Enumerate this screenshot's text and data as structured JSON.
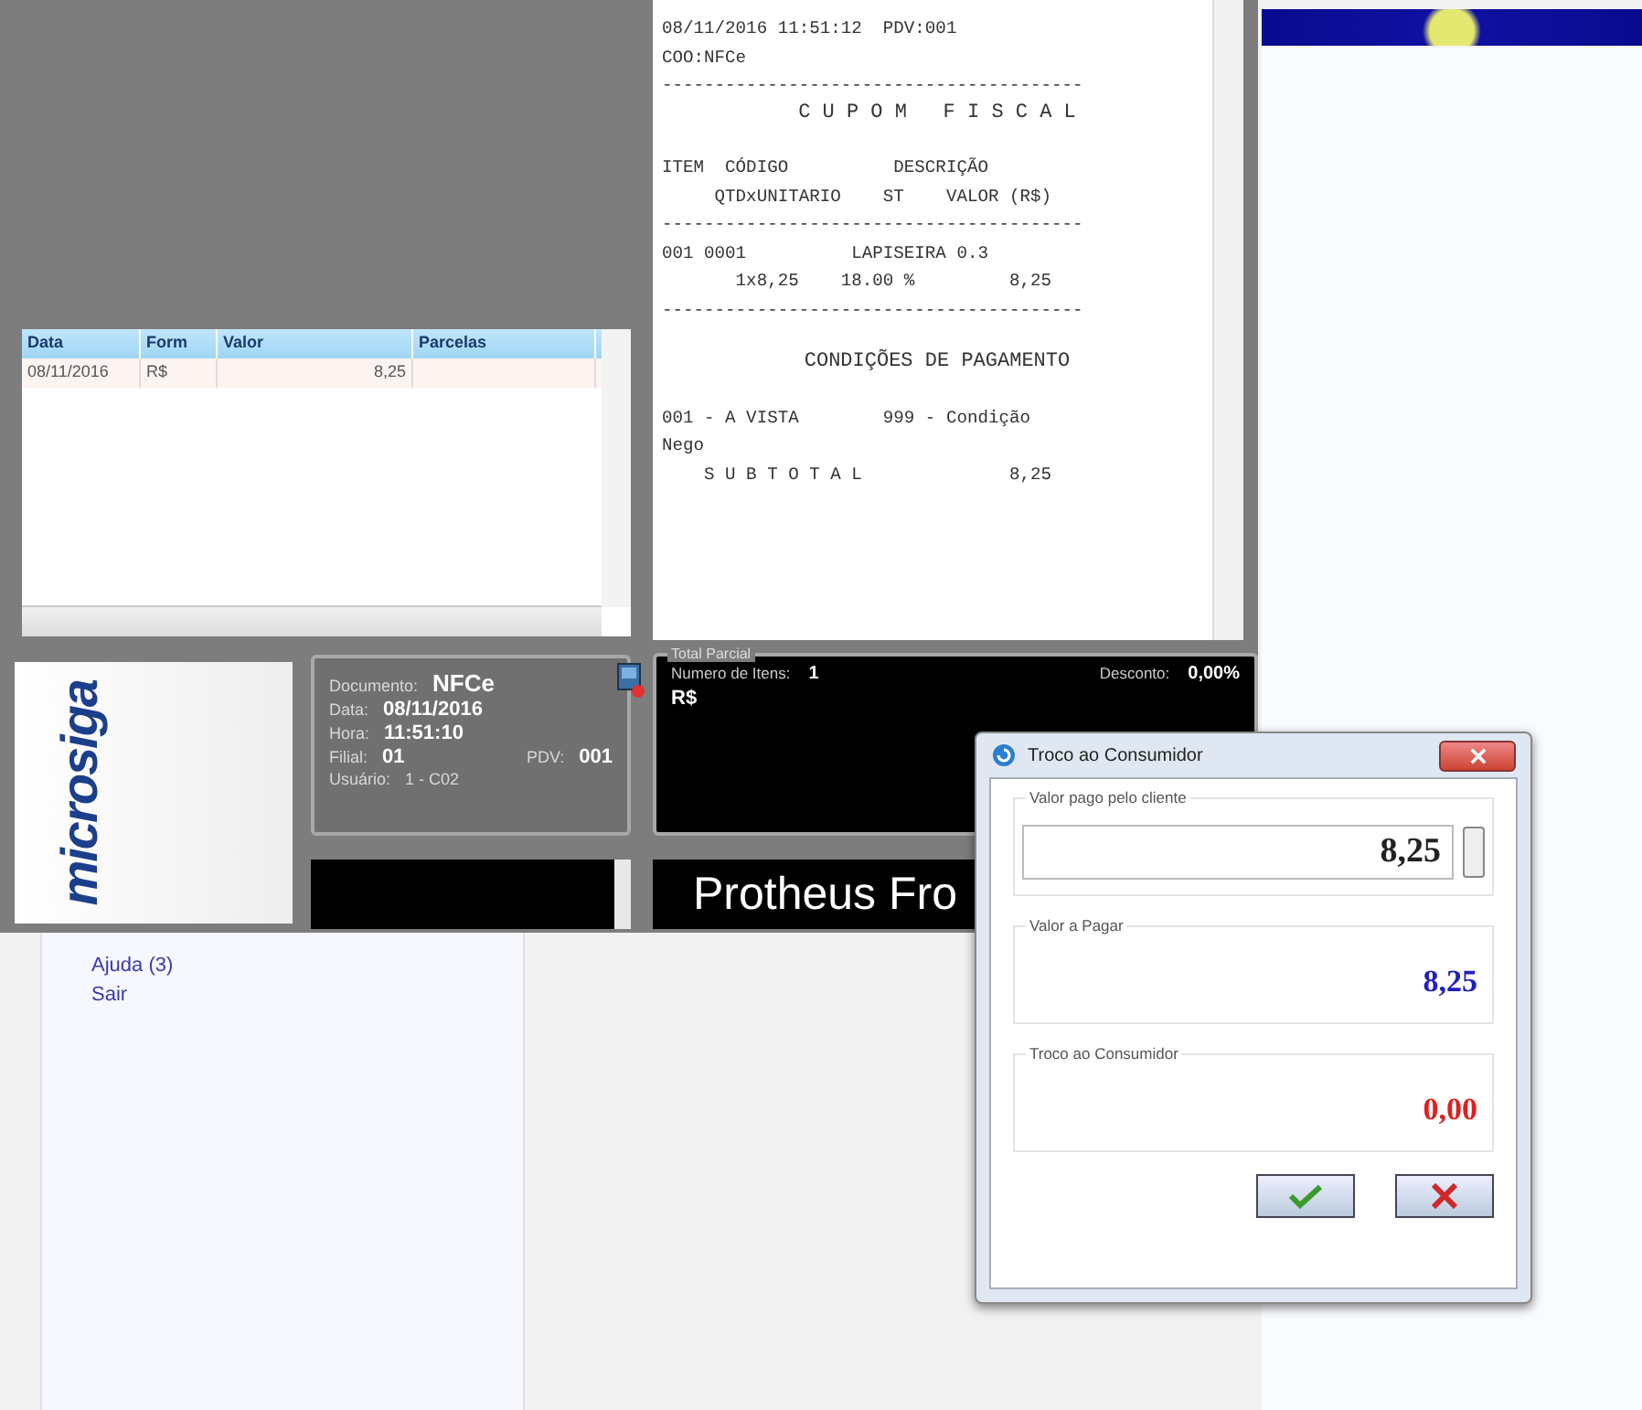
{
  "sidebar": {
    "links": [
      "Ajuda (3)",
      "Sair"
    ]
  },
  "pos": {
    "payments": {
      "columns": [
        "Data",
        "Form",
        "Valor",
        "Parcelas"
      ],
      "rows": [
        [
          "08/11/2016",
          "R$",
          "8,25",
          ""
        ]
      ]
    },
    "receipt": {
      "lines": [
        {
          "kind": "text",
          "text": "08/11/2016 11:51:12  PDV:001"
        },
        {
          "kind": "text",
          "text": "COO:NFCe"
        },
        {
          "kind": "rule",
          "text": "----------------------------------------"
        },
        {
          "kind": "title",
          "text": "C U P O M   F I S C A L"
        },
        {
          "kind": "blank"
        },
        {
          "kind": "text",
          "text": "ITEM  CÓDIGO          DESCRIÇÃO"
        },
        {
          "kind": "text",
          "text": "     QTDxUNITARIO    ST    VALOR (R$)"
        },
        {
          "kind": "rule",
          "text": "----------------------------------------"
        },
        {
          "kind": "text",
          "text": "001 0001          LAPISEIRA 0.3"
        },
        {
          "kind": "text",
          "text": "       1x8,25    18.00 %         8,25"
        },
        {
          "kind": "rule",
          "text": "----------------------------------------"
        },
        {
          "kind": "blank"
        },
        {
          "kind": "title",
          "text": "CONDIÇÕES DE PAGAMENTO"
        },
        {
          "kind": "blank"
        },
        {
          "kind": "text",
          "text": "001 - A VISTA        999 - Condição"
        },
        {
          "kind": "text",
          "text": "Nego"
        },
        {
          "kind": "text",
          "text": "    S U B T O T A L              8,25"
        }
      ]
    },
    "logo": "microsiga",
    "info": {
      "document_label": "Documento:",
      "document": "NFCe",
      "date_label": "Data:",
      "date": "08/11/2016",
      "time_label": "Hora:",
      "time": "11:51:10",
      "branch_label": "Filial:",
      "branch": "01",
      "pdv_label": "PDV:",
      "pdv": "001",
      "user_label": "Usuário:",
      "user": "1 - C02"
    },
    "total": {
      "legend": "Total Parcial",
      "items_label": "Numero de Itens:",
      "items": "1",
      "discount_label": "Desconto:",
      "discount": "0,00%",
      "currency": "R$"
    },
    "banner": "Protheus Fro"
  },
  "dialog": {
    "title": "Troco ao Consumidor",
    "fields": [
      {
        "kind": "input",
        "label": "Valor pago pelo cliente",
        "value": "8,25"
      },
      {
        "kind": "display",
        "label": "Valor a Pagar",
        "value": "8,25",
        "color": "#2020c0"
      },
      {
        "kind": "display",
        "label": "Troco ao Consumidor",
        "value": "0,00",
        "color": "#e02020"
      }
    ]
  }
}
